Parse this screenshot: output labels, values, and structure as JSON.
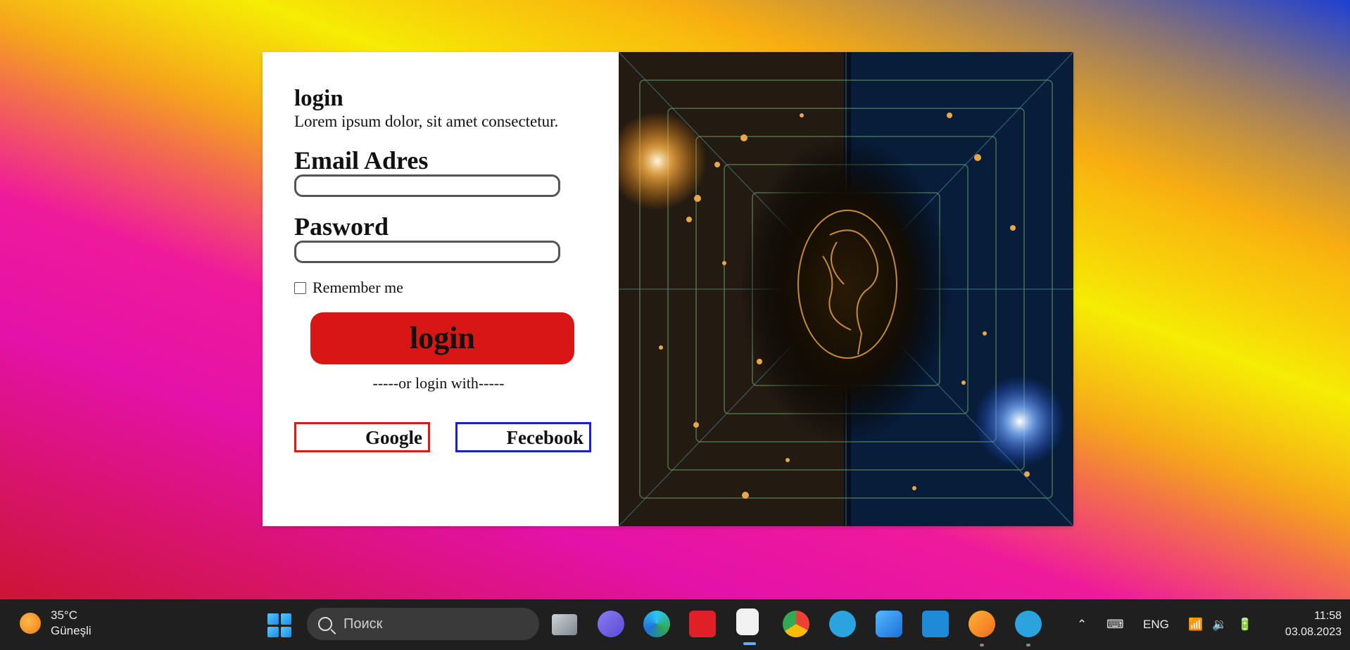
{
  "login": {
    "title": "login",
    "subtitle": "Lorem ipsum dolor, sit amet consectetur.",
    "email_label": "Email Adres",
    "email_value": "",
    "password_label": "Pasword",
    "password_value": "",
    "remember_label": "Remember me",
    "remember_checked": false,
    "login_button": "login",
    "divider": "-----or login with-----",
    "google_button": "Google",
    "facebook_button": "Fecebook"
  },
  "colors": {
    "login_button": "#d91616",
    "google_border": "#e01818",
    "facebook_border": "#1a1fd6"
  },
  "taskbar": {
    "weather_temp": "35°C",
    "weather_desc": "Güneşli",
    "search_placeholder": "Поиск",
    "language": "ENG",
    "time": "11:58",
    "date": "03.08.2023",
    "apps": [
      "task-view-icon",
      "chat-icon",
      "edge-icon",
      "wps-office-icon",
      "snipping-tool-icon",
      "chrome-icon",
      "telegram-icon",
      "photos-icon",
      "vscode-icon",
      "brave-icon",
      "telegram-icon"
    ]
  }
}
